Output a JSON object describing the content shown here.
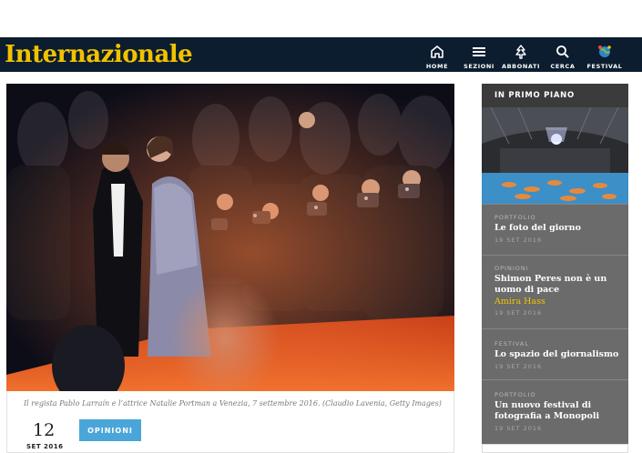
{
  "header": {
    "logo": "Internazionale",
    "nav": [
      {
        "label": "HOME",
        "icon": "home-icon"
      },
      {
        "label": "SEZIONI",
        "icon": "menu-icon"
      },
      {
        "label": "ABBONATI",
        "icon": "subscribe-icon"
      },
      {
        "label": "CERCA",
        "icon": "search-icon"
      },
      {
        "label": "FESTIVAL",
        "icon": "festival-icon"
      }
    ]
  },
  "article": {
    "caption": "Il regista Pablo Larraín e l’attrice Natalie Portman a Venezia, 7 settembre 2016. (Claudio Lavenia, Getty Images)",
    "day": "12",
    "month": "SET 2016",
    "tag": "OPINIONI"
  },
  "sidebar": {
    "title": "IN PRIMO PIANO",
    "items": [
      {
        "category": "PORTFOLIO",
        "headline": "Le foto del giorno",
        "author": "",
        "date": "19 SET 2016"
      },
      {
        "category": "OPINIONI",
        "headline": "Shimon Peres non è un uomo di pace",
        "author": "Amira Hass",
        "date": "19 SET 2016"
      },
      {
        "category": "FESTIVAL",
        "headline": "Lo spazio del giornalismo",
        "author": "",
        "date": "19 SET 2016"
      },
      {
        "category": "PORTFOLIO",
        "headline": "Un nuovo festival di fotografia a Monopoli",
        "author": "",
        "date": "19 SET 2016"
      }
    ]
  },
  "colors": {
    "header_bg": "#0c1d2f",
    "logo": "#f2c200",
    "tag_bg": "#4aa6d9",
    "sidebar_bg": "#6b6b6b",
    "sidebar_title_bg": "#3b3b3b",
    "author": "#f2c200"
  }
}
